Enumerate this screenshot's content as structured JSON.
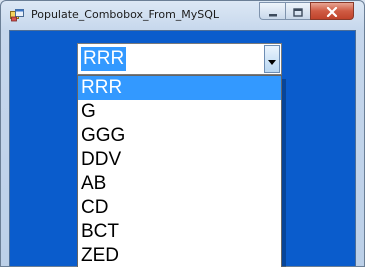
{
  "window": {
    "title": "Populate_Combobox_From_MySQL"
  },
  "icons": {
    "app": "app-window-icon",
    "minimize": "minimize-icon",
    "maximize": "maximize-icon",
    "close": "close-icon",
    "dropdown": "chevron-down-icon"
  },
  "colors": {
    "client_background": "#0a5ccc",
    "selection": "#3399ff",
    "close_button": "#c0432b"
  },
  "combobox": {
    "selected_value": "RRR",
    "options": [
      "RRR",
      "G",
      "GGG",
      "DDV",
      "AB",
      "CD",
      "BCT",
      "ZED"
    ],
    "highlighted_index": 0
  }
}
